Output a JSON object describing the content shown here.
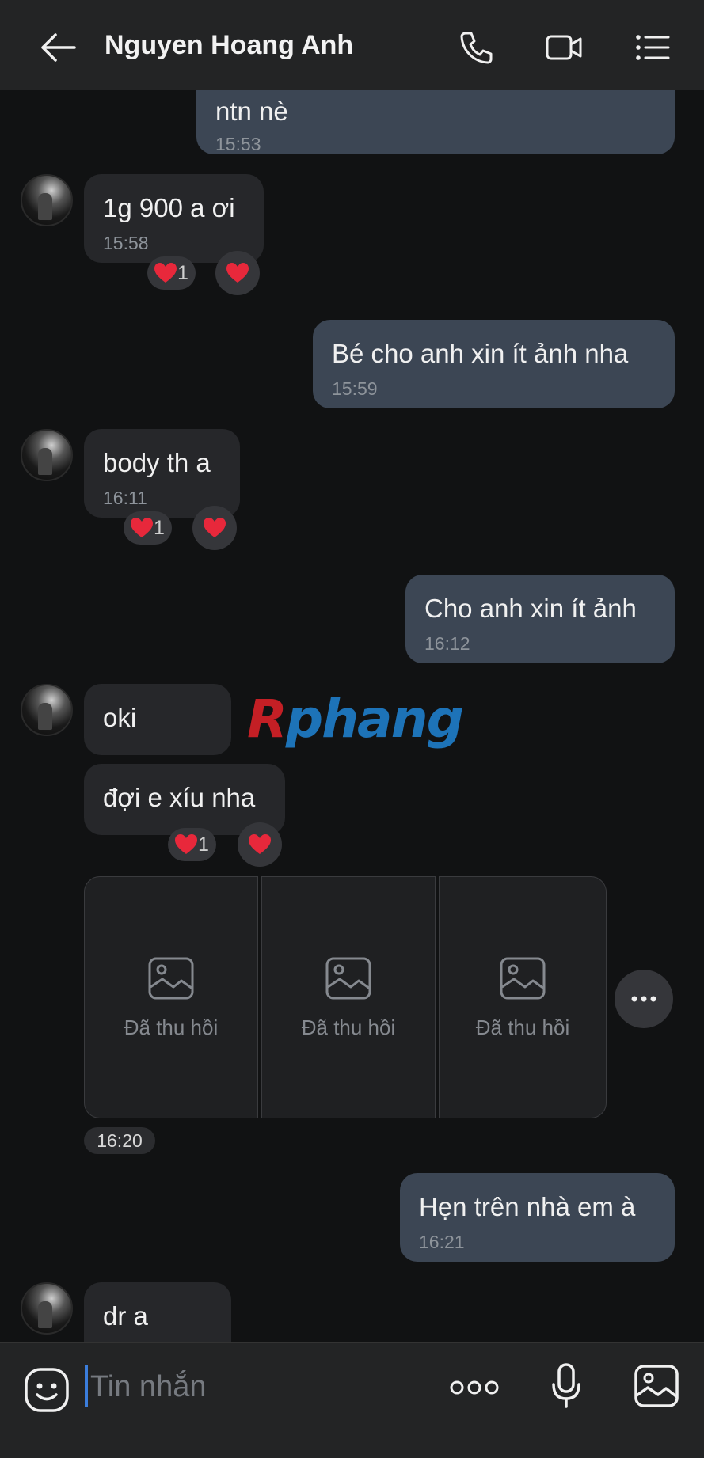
{
  "header": {
    "title": "Nguyen Hoang Anh",
    "icons": [
      "back-arrow-icon",
      "phone-icon",
      "video-call-icon",
      "menu-list-icon"
    ]
  },
  "messages": [
    {
      "id": "m0",
      "side": "out",
      "text": "ntn nè",
      "time": "15:53"
    },
    {
      "id": "m1",
      "side": "in",
      "text": "1g 900 a ơi",
      "time": "15:58",
      "reaction_count": "1"
    },
    {
      "id": "m2",
      "side": "out",
      "text": "Bé cho anh xin ít ảnh nha",
      "time": "15:59"
    },
    {
      "id": "m3",
      "side": "in",
      "text": "body th a",
      "time": "16:11",
      "reaction_count": "1"
    },
    {
      "id": "m4",
      "side": "out",
      "text": "Cho anh xin ít ảnh",
      "time": "16:12"
    },
    {
      "id": "m5",
      "side": "in",
      "text": "oki"
    },
    {
      "id": "m6",
      "side": "in",
      "text": "đợi e xíu nha",
      "reaction_count": "1"
    },
    {
      "id": "m7",
      "side": "in",
      "type": "photos",
      "labels": [
        "Đã thu hồi",
        "Đã thu hồi",
        "Đã thu hồi"
      ],
      "time": "16:20"
    },
    {
      "id": "m8",
      "side": "out",
      "text": "Hẹn trên nhà em à",
      "time": "16:21"
    },
    {
      "id": "m9",
      "side": "in",
      "text": "dr a"
    }
  ],
  "watermark": {
    "part1": "R",
    "part2": "phang"
  },
  "composer": {
    "placeholder": "Tin nhắn",
    "icons": [
      "emoji-icon",
      "more-dots-icon",
      "microphone-icon",
      "image-icon"
    ]
  },
  "colors": {
    "background": "#111213",
    "header": "#232425",
    "outgoing_bubble": "#3c4654",
    "incoming_bubble": "#26272a",
    "heart": "#e8283b",
    "cursor": "#3b7ddb"
  }
}
